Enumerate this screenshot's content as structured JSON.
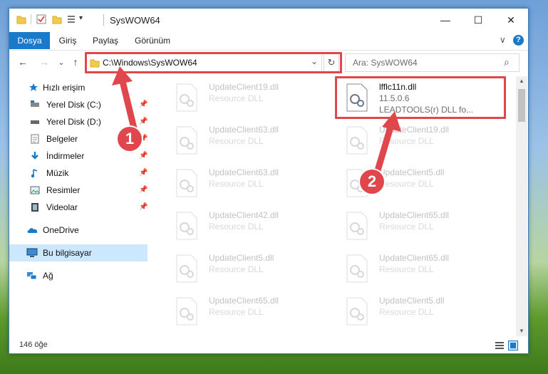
{
  "window": {
    "title": "SysWOW64"
  },
  "window_controls": {
    "minimize": "—",
    "maximize": "☐",
    "close": "✕"
  },
  "ribbon": {
    "tabs": [
      "Dosya",
      "Giriş",
      "Paylaş",
      "Görünüm"
    ],
    "collapse": "∨",
    "help": "?"
  },
  "nav": {
    "back": "←",
    "forward": "→",
    "recent": "⌄",
    "up": "↑"
  },
  "address": {
    "path": "C:\\Windows\\SysWOW64",
    "dropdown": "⌄",
    "refresh": "↻"
  },
  "search": {
    "placeholder": "Ara: SysWOW64",
    "icon": "⌕"
  },
  "sidebar": {
    "items": [
      {
        "label": "Hızlı erişim",
        "icon": "star-icon",
        "pin": ""
      },
      {
        "label": "Yerel Disk (C:)",
        "icon": "drive-c-icon",
        "pin": "📌"
      },
      {
        "label": "Yerel Disk (D:)",
        "icon": "drive-d-icon",
        "pin": "📌"
      },
      {
        "label": "Belgeler",
        "icon": "documents-icon",
        "pin": "📌"
      },
      {
        "label": "İndirmeler",
        "icon": "downloads-icon",
        "pin": "📌"
      },
      {
        "label": "Müzik",
        "icon": "music-icon",
        "pin": "📌"
      },
      {
        "label": "Resimler",
        "icon": "pictures-icon",
        "pin": "📌"
      },
      {
        "label": "Videolar",
        "icon": "videos-icon",
        "pin": "📌"
      },
      {
        "label": "OneDrive",
        "icon": "onedrive-icon",
        "pin": ""
      },
      {
        "label": "Bu bilgisayar",
        "icon": "this-pc-icon",
        "pin": ""
      },
      {
        "label": "Ağ",
        "icon": "network-icon",
        "pin": ""
      }
    ]
  },
  "files": {
    "left_column": [
      {
        "name": "UpdateClient19.dll",
        "sub": "Resource DLL"
      },
      {
        "name": "UpdateClient63.dll",
        "sub": "Resource DLL"
      },
      {
        "name": "UpdateClient63.dll",
        "sub": "Resource DLL"
      },
      {
        "name": "UpdateClient42.dll",
        "sub": "Resource DLL"
      },
      {
        "name": "UpdateClient5.dll",
        "sub": "Resource DLL"
      },
      {
        "name": "UpdateClient65.dll",
        "sub": "Resource DLL"
      }
    ],
    "right_column": [
      {
        "name": "UpdateClient19.dll",
        "sub": "Resource DLL"
      },
      {
        "name": "UpdateClient5.dll",
        "sub": "Resource DLL"
      },
      {
        "name": "UpdateClient65.dll",
        "sub": "Resource DLL"
      },
      {
        "name": "UpdateClient65.dll",
        "sub": "Resource DLL"
      },
      {
        "name": "UpdateClient5.dll",
        "sub": "Resource DLL"
      }
    ],
    "highlighted": {
      "name": "lfflc11n.dll",
      "version": "11.5.0.6",
      "description": "LEADTOOLS(r) DLL fo..."
    }
  },
  "status": {
    "count": "146 öğe"
  },
  "callouts": [
    "1",
    "2"
  ],
  "colors": {
    "accent": "#1979ca",
    "highlight": "#e0474c",
    "selected": "#cce8ff"
  }
}
